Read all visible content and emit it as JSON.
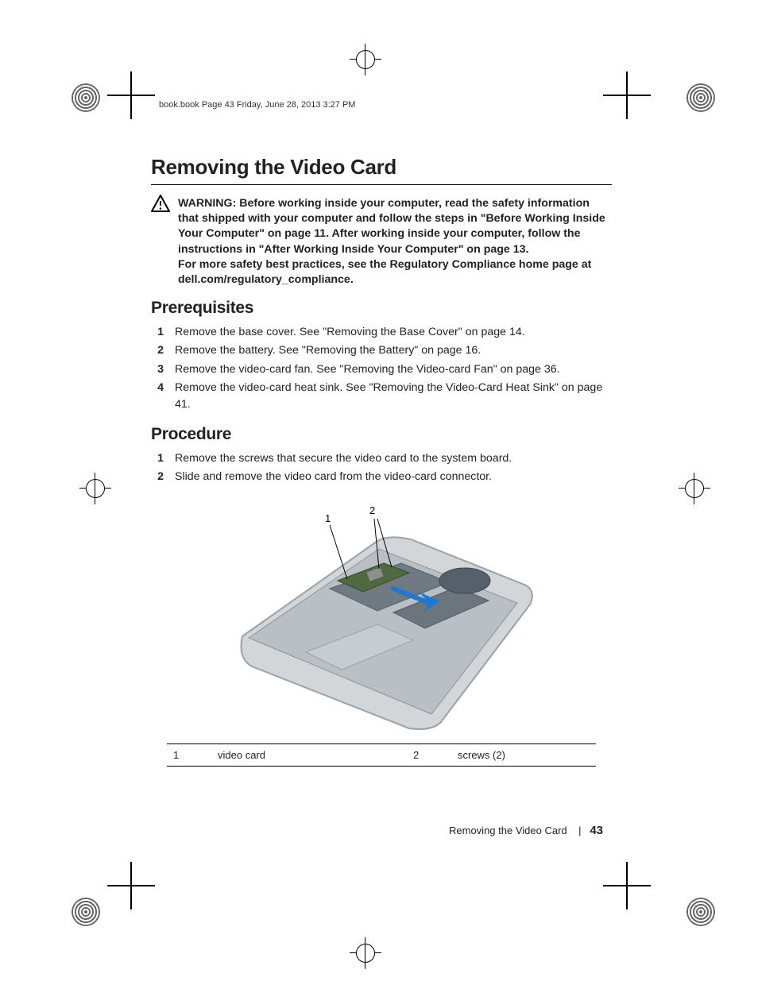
{
  "runhead": "book.book  Page 43  Friday, June 28, 2013  3:27 PM",
  "title": "Removing the Video Card",
  "warning": {
    "label": "WARNING:",
    "text": "Before working inside your computer, read the safety information that shipped with your computer and follow the steps in \"Before Working Inside Your Computer\" on page 11. After working inside your computer, follow the instructions in \"After Working Inside Your Computer\" on page 13.",
    "extra": "For more safety best practices, see the Regulatory Compliance home page at dell.com/regulatory_compliance."
  },
  "sections": {
    "prereq": {
      "heading": "Prerequisites",
      "items": [
        "Remove the base cover. See \"Removing the Base Cover\" on page 14.",
        "Remove the battery. See \"Removing the Battery\" on page 16.",
        "Remove the video-card fan. See \"Removing the Video-card Fan\" on page 36.",
        "Remove the video-card heat sink. See \"Removing the Video-Card Heat Sink\" on page 41."
      ]
    },
    "proc": {
      "heading": "Procedure",
      "items": [
        "Remove the screws that secure the video card to the system board.",
        "Slide and remove the video card from the video-card connector."
      ]
    }
  },
  "callouts": {
    "c1": "1",
    "c2": "2"
  },
  "key_rows": [
    {
      "n": "1",
      "label": "video card"
    },
    {
      "n": "2",
      "label": "screws (2)"
    }
  ],
  "footer": {
    "title": "Removing the Video Card",
    "sep": "|",
    "page": "43"
  }
}
